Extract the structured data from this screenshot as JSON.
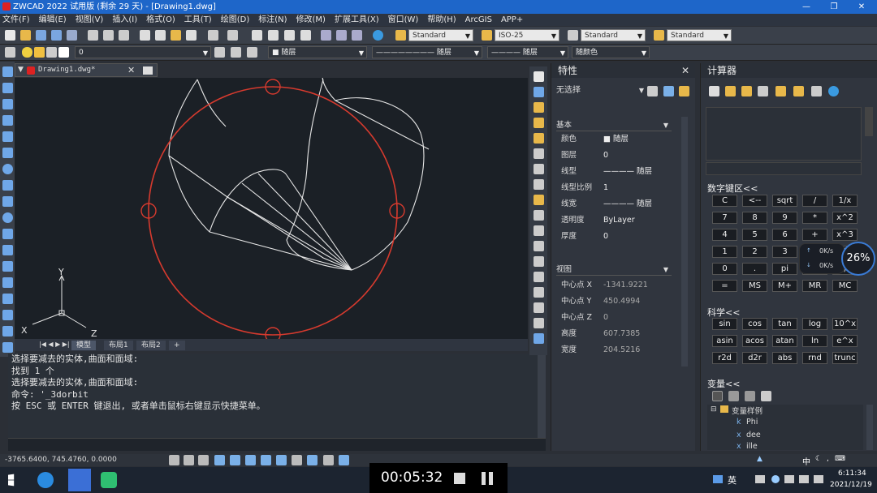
{
  "window": {
    "title": "ZWCAD 2022 试用版 (剩余 29 天) - [Drawing1.dwg]",
    "minimize": "—",
    "restore": "❐",
    "close": "✕"
  },
  "menu": [
    "文件(F)",
    "编辑(E)",
    "视图(V)",
    "插入(I)",
    "格式(O)",
    "工具(T)",
    "绘图(D)",
    "标注(N)",
    "修改(M)",
    "扩展工具(X)",
    "窗口(W)",
    "帮助(H)",
    "ArcGIS",
    "APP+"
  ],
  "toolbar": {
    "text_style": "Standard",
    "dim_style": "ISO-25",
    "table_style": "Standard",
    "mleader_style": "Standard",
    "layer_value": "0",
    "color_value": "随层",
    "linetype_value": "随层",
    "lineweight_value": "随层",
    "plot_style_value": "随颜色"
  },
  "drawing_tab": {
    "label": "Drawing1.dwg*"
  },
  "viewport": {
    "axis_y": "Y",
    "axis_x": "X",
    "axis_z": "Z"
  },
  "layout_tabs": [
    "模型",
    "布局1",
    "布局2",
    "+"
  ],
  "command_lines": [
    "选择要减去的实体,曲面和面域:",
    "找到 1 个",
    "选择要减去的实体,曲面和面域:",
    "命令: '_3dorbit",
    "按 ESC 或 ENTER 键退出, 或者单击鼠标右键显示快捷菜单。"
  ],
  "status": {
    "coords": "-3765.6400, 745.4760, 0.0000"
  },
  "properties": {
    "title": "特性",
    "selection": "无选择",
    "basic_section": "基本",
    "basic": [
      {
        "k": "颜色",
        "v": "随层"
      },
      {
        "k": "图层",
        "v": "0"
      },
      {
        "k": "线型",
        "v": "———— 随层"
      },
      {
        "k": "线型比例",
        "v": "1"
      },
      {
        "k": "线宽",
        "v": "———— 随层"
      },
      {
        "k": "透明度",
        "v": "ByLayer"
      },
      {
        "k": "厚度",
        "v": "0"
      }
    ],
    "view_section": "视图",
    "view": [
      {
        "k": "中心点 X",
        "v": "-1341.9221"
      },
      {
        "k": "中心点 Y",
        "v": "450.4994"
      },
      {
        "k": "中心点 Z",
        "v": "0"
      },
      {
        "k": "高度",
        "v": "607.7385"
      },
      {
        "k": "宽度",
        "v": "204.5216"
      }
    ]
  },
  "calculator": {
    "title": "计算器",
    "numpad_section": "数字键区<<",
    "numpad": [
      [
        "C",
        "<--",
        "sqrt",
        "/",
        "1/x"
      ],
      [
        "7",
        "8",
        "9",
        "*",
        "x^2"
      ],
      [
        "4",
        "5",
        "6",
        "+",
        "x^3"
      ],
      [
        "1",
        "2",
        "3",
        "-",
        "x^y"
      ],
      [
        "0",
        ".",
        "pi",
        "(",
        ")"
      ],
      [
        "=",
        "MS",
        "M+",
        "MR",
        "MC"
      ]
    ],
    "sci_section": "科学<<",
    "sci": [
      [
        "sin",
        "cos",
        "tan",
        "log",
        "10^x"
      ],
      [
        "asin",
        "acos",
        "atan",
        "ln",
        "e^x"
      ],
      [
        "r2d",
        "d2r",
        "abs",
        "rnd",
        "trunc"
      ]
    ],
    "var_section": "变量<<",
    "var_tree_root": "变量样例",
    "var_items": [
      "Phi",
      "dee",
      "ille"
    ]
  },
  "network": {
    "up": "0K/s",
    "down": "0K/s",
    "percent": "26%"
  },
  "timer": {
    "elapsed": "00:05:32"
  },
  "tray": {
    "ime": "英",
    "ime2": "中",
    "time": "6:11:34",
    "date": "2021/12/19"
  },
  "colors": {
    "circle": "#d63a2e",
    "drawing": "#e6e6e6",
    "titlebar": "#1e66c9"
  }
}
